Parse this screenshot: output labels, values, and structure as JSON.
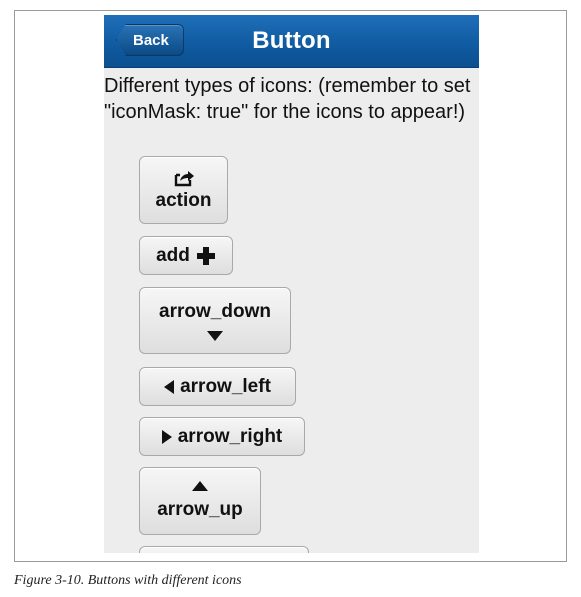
{
  "header": {
    "back_label": "Back",
    "title": "Button"
  },
  "intro_text": "Different types of icons: (remember to set \"iconMask: true\" for the icons to appear!)",
  "buttons": [
    {
      "label": "action",
      "icon": "action-icon"
    },
    {
      "label": "add",
      "icon": "plus-icon"
    },
    {
      "label": "arrow_down",
      "icon": "arrow-down-icon"
    },
    {
      "label": "arrow_left",
      "icon": "arrow-left-icon"
    },
    {
      "label": "arrow_right",
      "icon": "arrow-right-icon"
    },
    {
      "label": "arrow_up",
      "icon": "arrow-up-icon"
    }
  ],
  "caption": "Figure 3-10. Buttons with different icons",
  "colors": {
    "titlebar": "#0f5aa0",
    "background": "#ededed",
    "button_text": "#111111"
  }
}
